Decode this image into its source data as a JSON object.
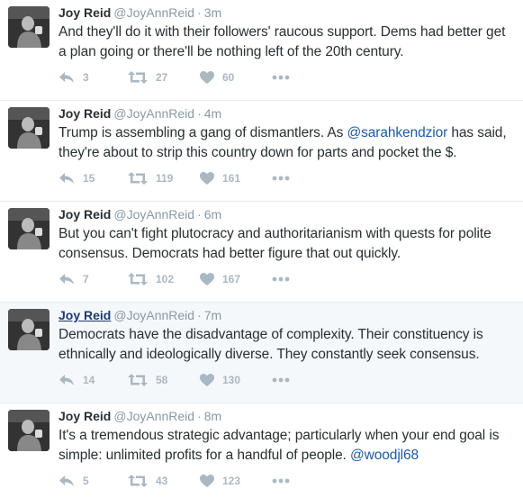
{
  "tweets": [
    {
      "name": "Joy Reid",
      "handle": "@JoyAnnReid",
      "sep": "·",
      "time": "3m",
      "text_parts": [
        "And they'll do it with their followers' raucous support. Dems had better get a plan going or there'll be nothing left of the 20th century."
      ],
      "reply_count": "3",
      "retweet_count": "27",
      "like_count": "60"
    },
    {
      "name": "Joy Reid",
      "handle": "@JoyAnnReid",
      "sep": "·",
      "time": "4m",
      "text_parts": [
        "Trump is assembling a gang of dismantlers. As ",
        "@sarahkendzior",
        " has said, they're about to strip this country down for parts and pocket the $."
      ],
      "reply_count": "15",
      "retweet_count": "119",
      "like_count": "161"
    },
    {
      "name": "Joy Reid",
      "handle": "@JoyAnnReid",
      "sep": "·",
      "time": "6m",
      "text_parts": [
        "But you can't fight plutocracy and authoritarianism with quests for polite consensus. Democrats had better figure that out quickly."
      ],
      "reply_count": "7",
      "retweet_count": "102",
      "like_count": "167"
    },
    {
      "name": "Joy Reid",
      "handle": "@JoyAnnReid",
      "sep": "·",
      "time": "7m",
      "text_parts": [
        "Democrats have the disadvantage of complexity. Their constituency is ethnically and ideologically diverse. They constantly seek consensus."
      ],
      "reply_count": "14",
      "retweet_count": "58",
      "like_count": "130"
    },
    {
      "name": "Joy Reid",
      "handle": "@JoyAnnReid",
      "sep": "·",
      "time": "8m",
      "text_parts": [
        "It's a tremendous strategic advantage; particularly when your end goal is simple: unlimited profits for a handful of people. ",
        "@woodjl68"
      ],
      "reply_count": "5",
      "retweet_count": "43",
      "like_count": "123"
    }
  ],
  "colors": {
    "text": "#292f33",
    "muted": "#8899a6",
    "mention": "#1b5aa8",
    "hover_bg": "#f5f8fa",
    "divider": "#e6ecf0"
  },
  "icons": {
    "avatar": "profile-photo",
    "reply": "reply-icon",
    "retweet": "retweet-icon",
    "like": "heart-icon",
    "more": "more-dots-icon"
  },
  "hovered_tweet_index": 3
}
